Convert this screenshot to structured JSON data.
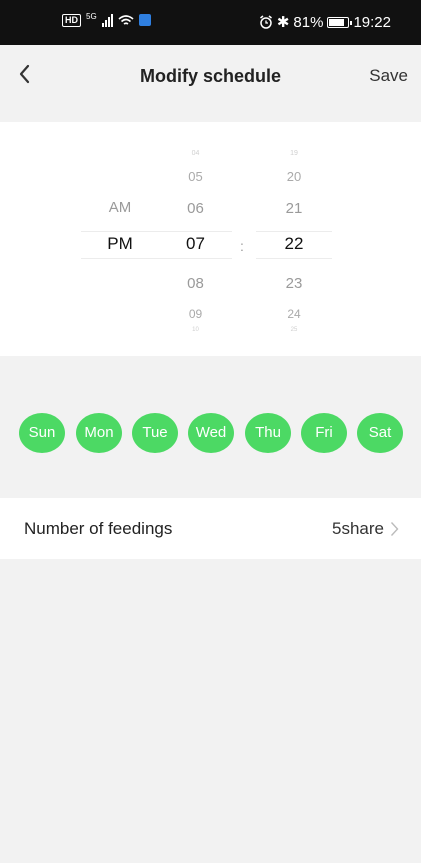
{
  "status_bar": {
    "network": "5G",
    "battery_percent": "81%",
    "battery_level": 0.81,
    "time": "19:22"
  },
  "header": {
    "title": "Modify schedule",
    "save_label": "Save"
  },
  "picker": {
    "ampm": [
      "AM",
      "PM"
    ],
    "hours": [
      "04",
      "05",
      "06",
      "07",
      "08",
      "09",
      "10"
    ],
    "minutes": [
      "19",
      "20",
      "21",
      "22",
      "23",
      "24",
      "25"
    ],
    "selected": {
      "ampm": "PM",
      "hour": "07",
      "minute": "22"
    },
    "separator": ":"
  },
  "days": [
    "Sun",
    "Mon",
    "Tue",
    "Wed",
    "Thu",
    "Fri",
    "Sat"
  ],
  "feedings": {
    "label": "Number of feedings",
    "value": "5share"
  },
  "colors": {
    "day_active": "#4cd964",
    "background": "#f2f2f2",
    "status_bar": "#111111"
  }
}
